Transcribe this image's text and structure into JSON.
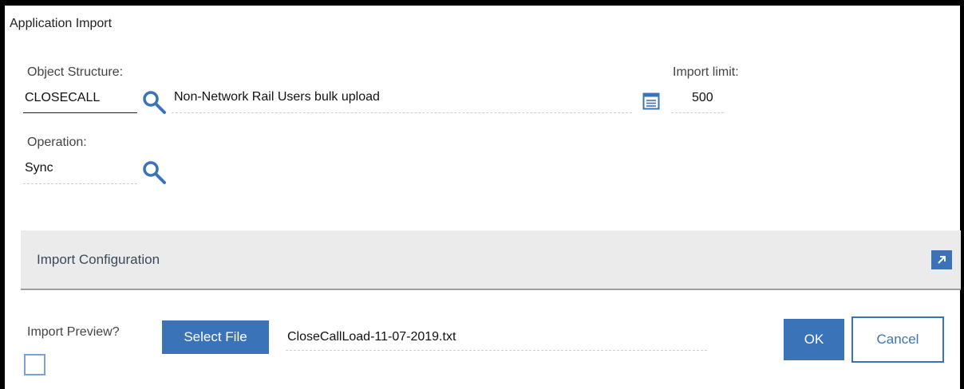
{
  "dialog": {
    "title": "Application Import"
  },
  "object_structure": {
    "label": "Object Structure:",
    "value": "CLOSECALL",
    "description": "Non-Network Rail Users bulk upload"
  },
  "import_limit": {
    "label": "Import limit:",
    "value": "500"
  },
  "operation": {
    "label": "Operation:",
    "value": "Sync"
  },
  "import_configuration": {
    "title": "Import Configuration"
  },
  "import_preview": {
    "label": "Import Preview?",
    "checked": false
  },
  "file": {
    "select_label": "Select File",
    "filename": "CloseCallLoad-11-07-2019.txt"
  },
  "buttons": {
    "ok_label": "OK",
    "cancel_label": "Cancel"
  },
  "icons": {
    "lookup": "search-icon",
    "long_description": "document-icon",
    "expand": "expand-arrow-icon"
  },
  "colors": {
    "accent": "#3b73b9",
    "section_bg": "#ebebeb"
  }
}
